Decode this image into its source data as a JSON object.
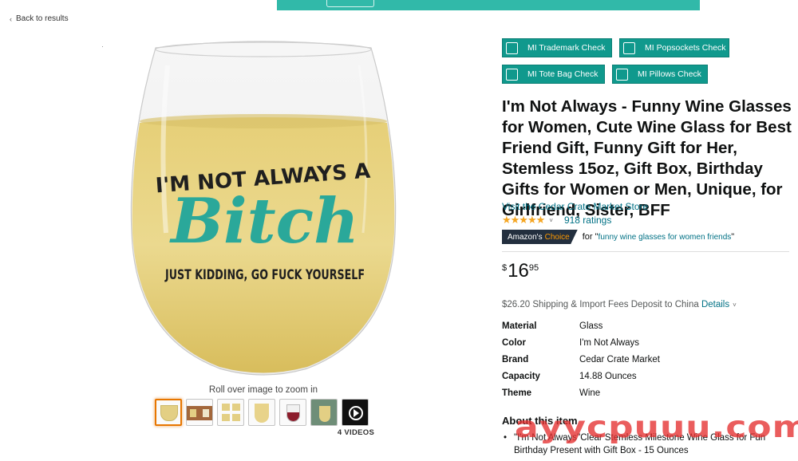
{
  "nav": {
    "back_label": "Back to results"
  },
  "product_image": {
    "line1": "I'M NOT ALWAYS A",
    "line2": "Bitch",
    "line3": "JUST KIDDING, GO FUCK YOURSELF",
    "zoom_hint": "Roll over image to zoom in",
    "videos_label": "4 VIDEOS"
  },
  "check_buttons": [
    {
      "label": "MI Trademark Check"
    },
    {
      "label": "MI Popsockets Check"
    },
    {
      "label": "MI Tote Bag Check"
    },
    {
      "label": "MI Pillows Check"
    }
  ],
  "product": {
    "title": "I'm Not Always - Funny Wine Glasses for Women, Cute Wine Glass for Best Friend Gift, Funny Gift for Her, Stemless 15oz, Gift Box, Birthday Gifts for Women or Men, Unique, for Girlfriend, Sister, BFF",
    "store_link": "Visit the Cedar Crate Market Store",
    "stars": "★★★★★",
    "ratings": "918 ratings",
    "choice": {
      "prefix": "Amazon's",
      "word": "Choice",
      "for_text": "for \"",
      "term": "funny wine glasses for women friends",
      "close": "\""
    },
    "price": {
      "currency": "$",
      "whole": "16",
      "fraction": "95"
    },
    "shipping": {
      "text": "$26.20 Shipping & Import Fees Deposit to China ",
      "details": "Details"
    },
    "specs": [
      {
        "key": "Material",
        "value": "Glass"
      },
      {
        "key": "Color",
        "value": "I'm Not Always"
      },
      {
        "key": "Brand",
        "value": "Cedar Crate Market"
      },
      {
        "key": "Capacity",
        "value": "14.88 Ounces"
      },
      {
        "key": "Theme",
        "value": "Wine"
      }
    ],
    "about_title": "About this item",
    "about_items": [
      "\"I'm Not Always\"Clear Stemless Milestone Wine Glass for Fun Birthday Present with Gift Box - 15 Ounces"
    ]
  },
  "watermark": "ауусрuuu.com",
  "colors": {
    "teal_button": "#10998d",
    "link": "#007185",
    "star": "#f5a623",
    "choice_badge": "#232f3e",
    "accent_orange": "#ff9900"
  }
}
